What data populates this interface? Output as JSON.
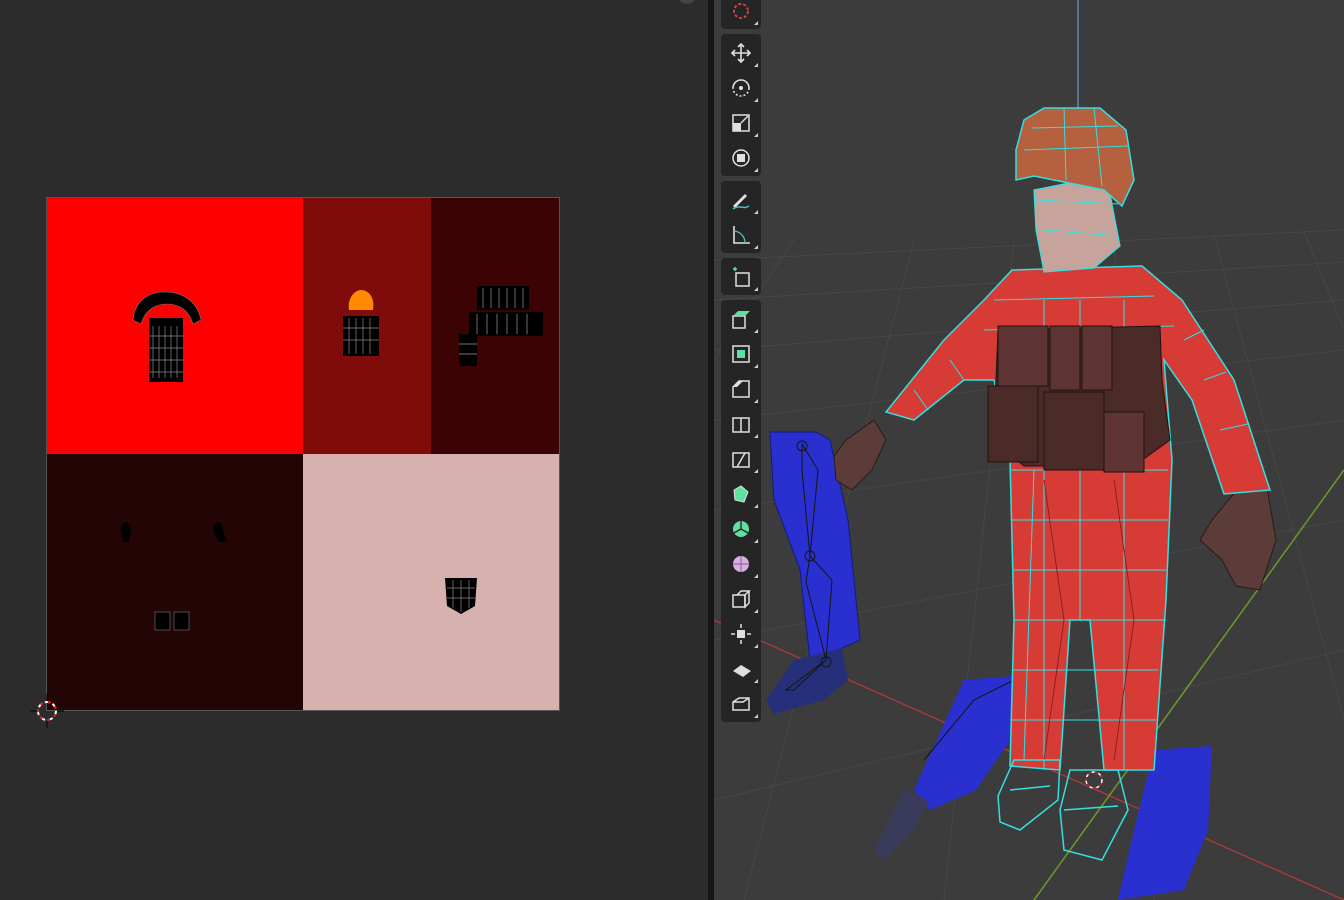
{
  "window": {
    "layout": "split",
    "left_editor": "uv-editor",
    "right_editor": "3d-viewport"
  },
  "colors": {
    "background_uv": "#2c2c2c",
    "background_viewport": "#3c3c3c",
    "texture_bright_red": "#ff0000",
    "texture_dark_red": "#7f0b0b",
    "texture_darker_red": "#3b0303",
    "texture_maroon": "#240505",
    "texture_pink": "#d7b1ad",
    "wire_select": "#33e0e0",
    "suit_red": "#d63b36",
    "armature_blue": "#2a30cf",
    "helmet_orange": "#b5603e",
    "vest_brown": "#4b2b28",
    "grid_x_axis": "#a23a3a",
    "grid_y_axis": "#6c9a2e"
  },
  "toolbar": {
    "tools": [
      {
        "name": "cursor-tool",
        "icon": "cursor-icon"
      },
      {
        "name": "move-tool",
        "icon": "move-arrows-icon"
      },
      {
        "name": "rotate-tool",
        "icon": "rotate-icon"
      },
      {
        "name": "scale-tool",
        "icon": "scale-icon"
      },
      {
        "name": "transform-tool",
        "icon": "transform-icon"
      },
      {
        "name": "annotate-tool",
        "icon": "pencil-icon"
      },
      {
        "name": "measure-tool",
        "icon": "ruler-icon"
      },
      {
        "name": "add-cube-tool",
        "icon": "add-cube-icon"
      },
      {
        "name": "extrude-tool",
        "icon": "extrude-icon"
      },
      {
        "name": "inset-tool",
        "icon": "inset-icon"
      },
      {
        "name": "bevel-tool",
        "icon": "bevel-icon"
      },
      {
        "name": "loop-cut-tool",
        "icon": "loop-cut-icon"
      },
      {
        "name": "knife-tool",
        "icon": "knife-icon"
      },
      {
        "name": "poly-build-tool",
        "icon": "poly-build-icon"
      },
      {
        "name": "spin-tool",
        "icon": "spin-icon"
      },
      {
        "name": "smooth-tool",
        "icon": "smooth-icon"
      },
      {
        "name": "edge-slide-tool",
        "icon": "edge-slide-icon"
      },
      {
        "name": "shrink-fatten-tool",
        "icon": "shrink-fatten-icon"
      },
      {
        "name": "shear-tool",
        "icon": "shear-icon"
      },
      {
        "name": "rip-region-tool",
        "icon": "rip-region-icon"
      }
    ]
  }
}
